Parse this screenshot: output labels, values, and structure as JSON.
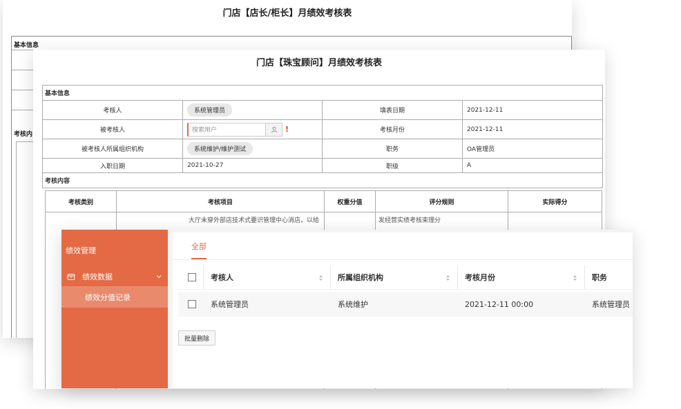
{
  "back_form": {
    "title": "门店【店长/柜长】月绩效考核表",
    "section_basic": "基本信息",
    "section_content": "考核内"
  },
  "form": {
    "title": "门店【珠宝顾问】月绩效考核表",
    "section_basic": "基本信息",
    "rows": [
      {
        "l1": "考核人",
        "v1": "系统管理员",
        "l2": "填表日期",
        "v2": "2021-12-11"
      },
      {
        "l1": "被考核人",
        "v1": "搜索用户",
        "l2": "考核月份",
        "v2": "2021-12-11"
      },
      {
        "l1": "被考核人所属组织机构",
        "v1": "系统维护/维护测试",
        "l2": "职务",
        "v2": "OA管理员"
      },
      {
        "l1": "入职日期",
        "v1": "2021-10-27",
        "l2": "职级",
        "v2": "A"
      }
    ],
    "required_mark": "!",
    "section_content": "考核内容",
    "content_headers": [
      "考核类别",
      "考核项目",
      "权重分值",
      "评分规则",
      "实际得分"
    ],
    "content_row": {
      "item_text": "大厅未穿外部店技术式要识管理中心消店，以给",
      "rule_text": "发经营实绩考核束理分"
    }
  },
  "sidebar": {
    "title": "绩效管理",
    "group_label": "绩效数据",
    "item_label": "绩效分值记录"
  },
  "list": {
    "tab_all": "全部",
    "headers": [
      "考核人",
      "所属组织机构",
      "考核月份",
      "职务"
    ],
    "rows": [
      {
        "reviewer": "系统管理员",
        "org": "系统维护",
        "month": "2021-12-11 00:00",
        "position": "系统管理员"
      }
    ],
    "batch_delete": "批量删除"
  },
  "colors": {
    "accent": "#e36a44",
    "required": "#e03b2e"
  }
}
